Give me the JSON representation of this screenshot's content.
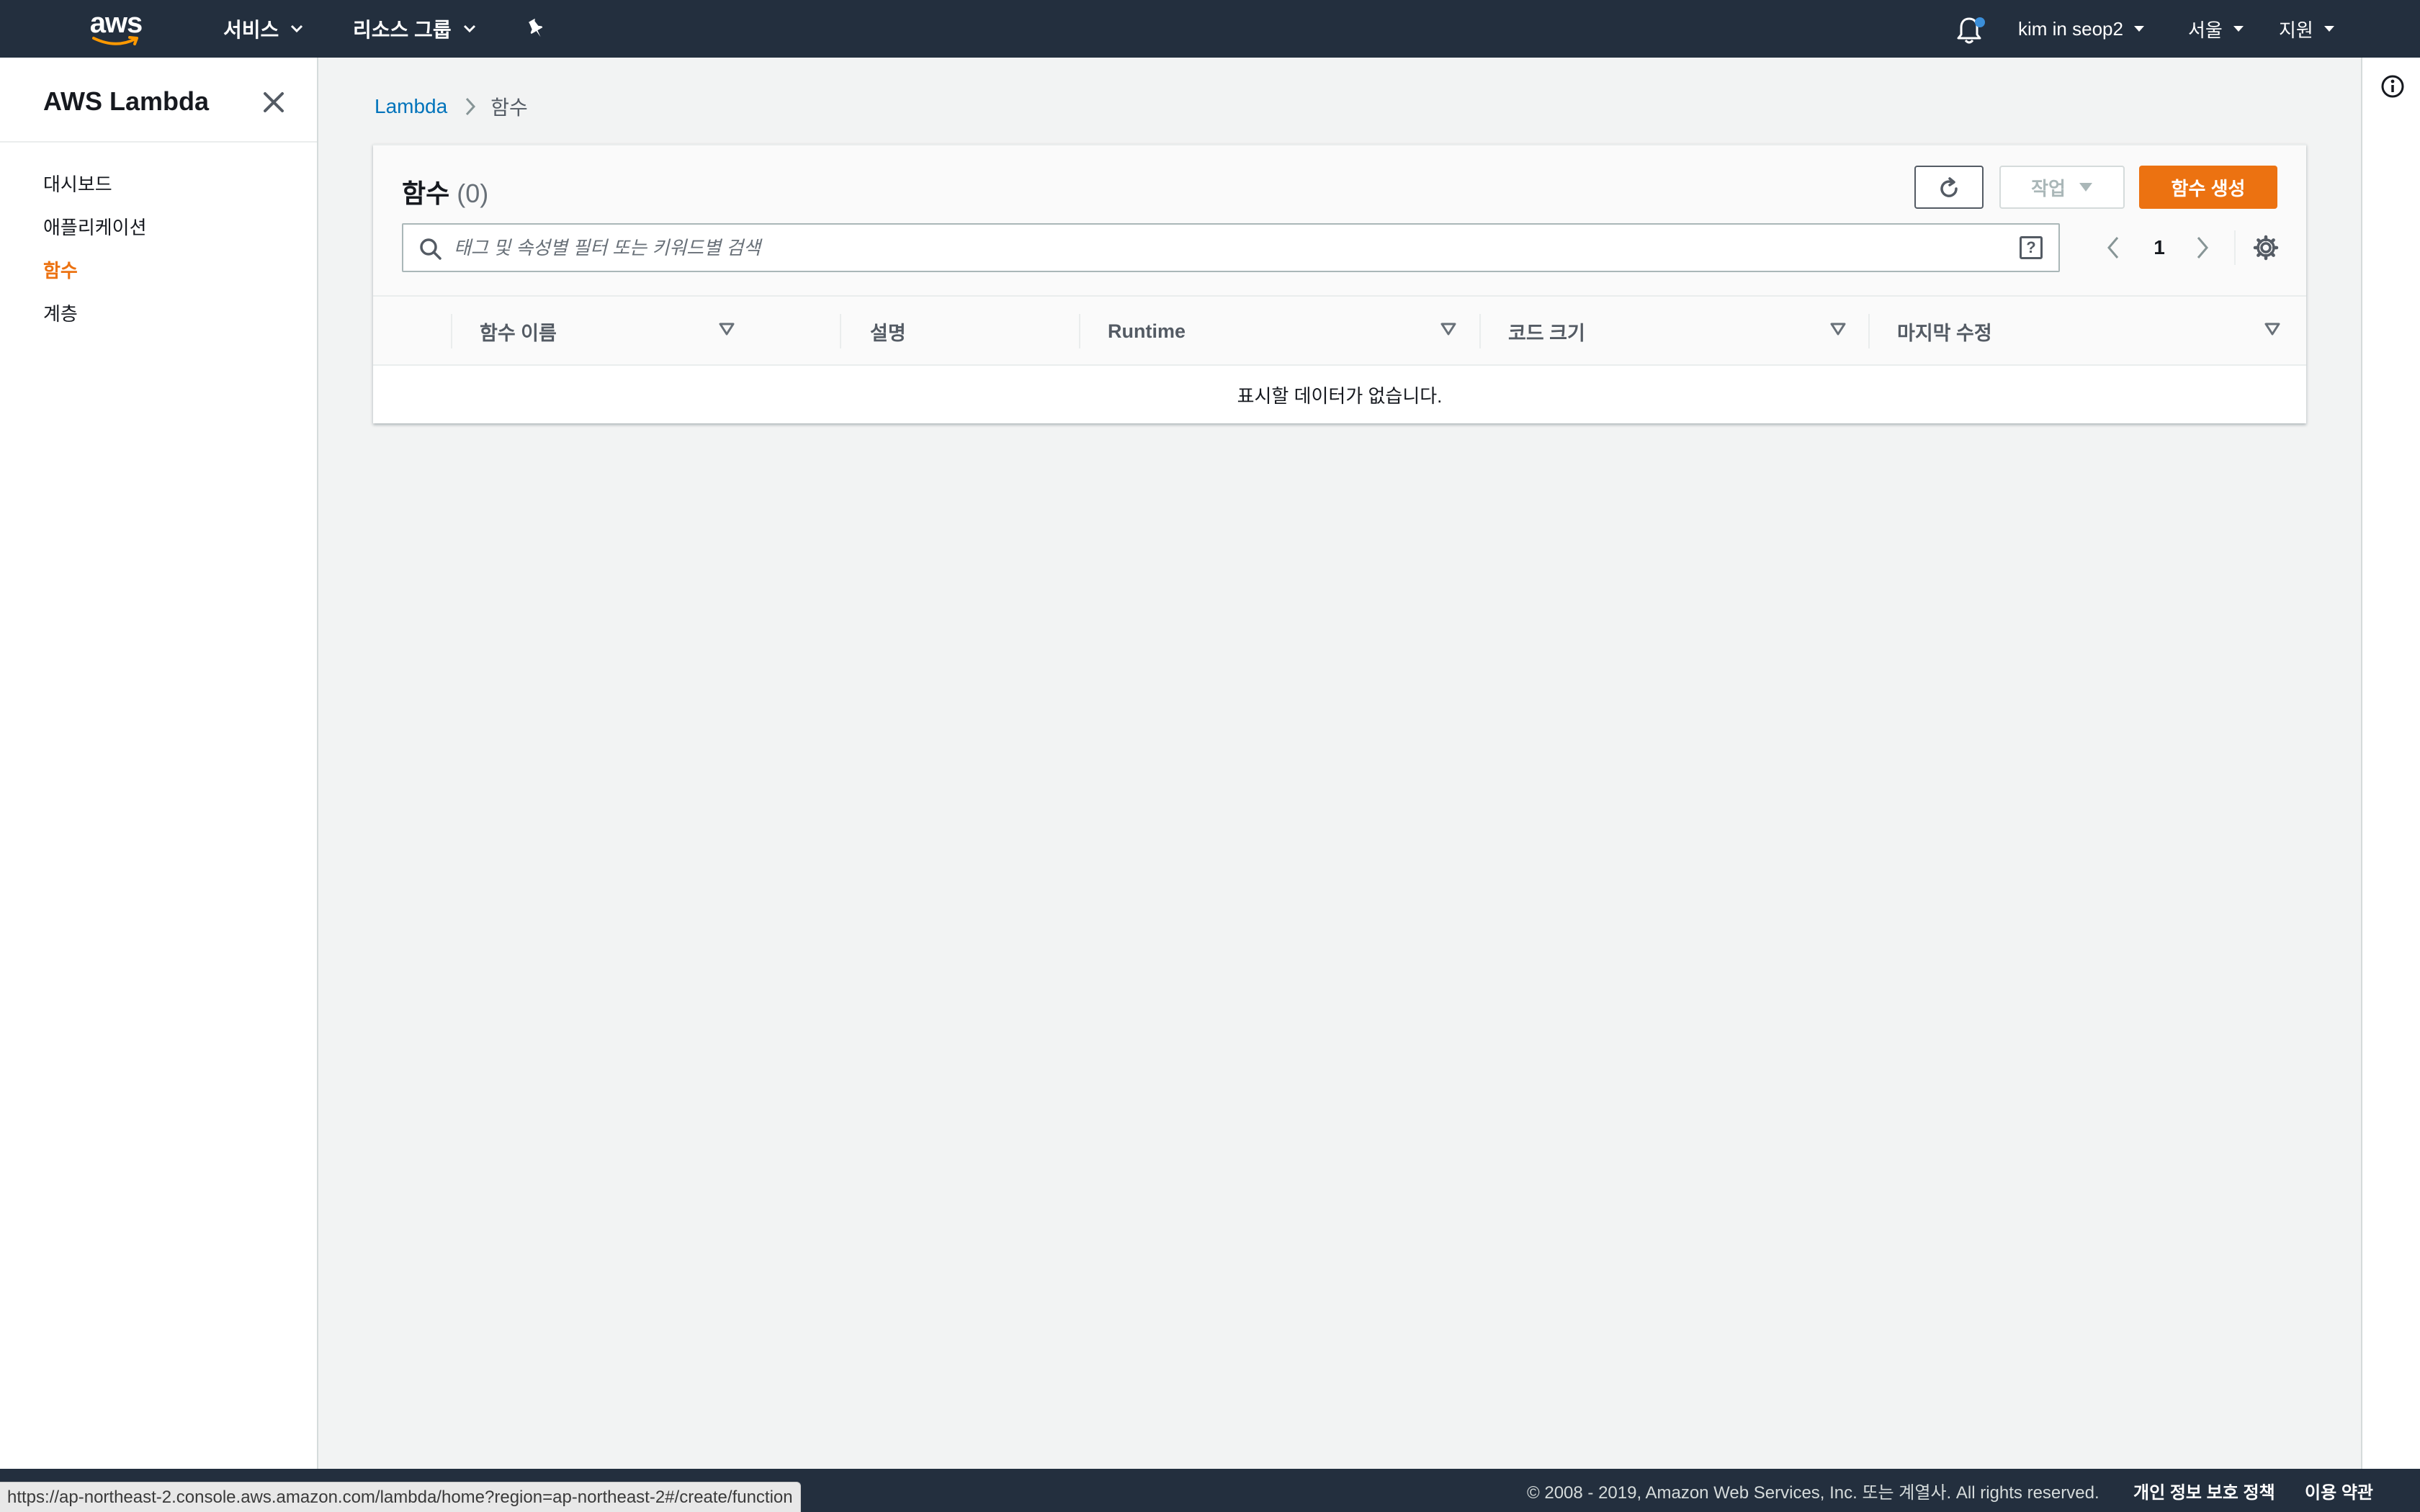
{
  "topnav": {
    "logo_text": "aws",
    "services_label": "서비스",
    "resource_groups_label": "리소스 그룹",
    "user_label": "kim in seop2",
    "region_label": "서울",
    "support_label": "지원"
  },
  "sidebar": {
    "title": "AWS Lambda",
    "items": [
      {
        "label": "대시보드"
      },
      {
        "label": "애플리케이션"
      },
      {
        "label": "함수"
      },
      {
        "label": "계층"
      }
    ]
  },
  "breadcrumb": {
    "root": "Lambda",
    "current": "함수"
  },
  "panel": {
    "title": "함수",
    "count": "(0)",
    "actions_label": "작업",
    "create_label": "함수 생성",
    "search_placeholder": "태그 및 속성별 필터 또는 키워드별 검색",
    "help_label": "?",
    "page_number": "1",
    "columns": [
      {
        "label": "함수 이름"
      },
      {
        "label": "설명"
      },
      {
        "label": "Runtime"
      },
      {
        "label": "코드 크기"
      },
      {
        "label": "마지막 수정"
      }
    ],
    "empty_message": "표시할 데이터가 없습니다."
  },
  "footer": {
    "copyright": "© 2008 - 2019, Amazon Web Services, Inc. 또는 계열사. All rights reserved.",
    "privacy_label": "개인 정보 보호 정책",
    "terms_label": "이용 약관"
  },
  "status_url": "https://ap-northeast-2.console.aws.amazon.com/lambda/home?region=ap-northeast-2#/create/function",
  "colors": {
    "nav_bg": "#232f3e",
    "accent": "#ec7211",
    "link": "#0073bb",
    "notification_dot": "#3b8fd9"
  }
}
